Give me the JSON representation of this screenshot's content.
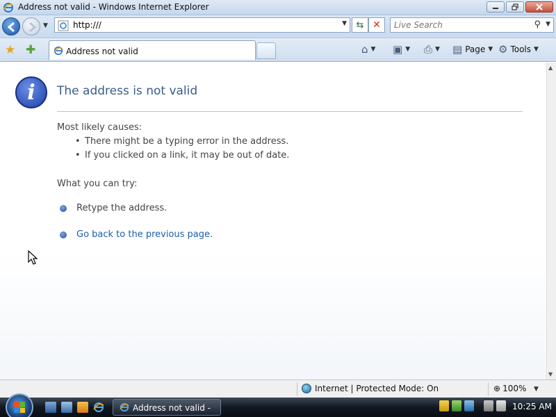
{
  "window": {
    "title": "Address not valid - Windows Internet Explorer"
  },
  "address_bar": {
    "url": "http:///"
  },
  "search": {
    "placeholder": "Live Search"
  },
  "tab": {
    "title": "Address not valid"
  },
  "command_bar": {
    "page_label": "Page",
    "tools_label": "Tools"
  },
  "error_page": {
    "heading": "The address is not valid",
    "causes_heading": "Most likely causes:",
    "causes": [
      "There might be a typing error in the address.",
      "If you clicked on a link, it may be out of date."
    ],
    "try_heading": "What you can try:",
    "try_items": [
      {
        "text": "Retype the address."
      },
      {
        "link": "Go back to the previous page."
      }
    ]
  },
  "status_bar": {
    "zone": "Internet | Protected Mode: On",
    "zoom": "100%"
  },
  "taskbar": {
    "task_label": "Address not valid - ...",
    "clock": "10:25 AM"
  },
  "colors": {
    "heading": "#3a5c8a",
    "link": "#1a5ea8",
    "info_icon": "#1c3fa8"
  }
}
